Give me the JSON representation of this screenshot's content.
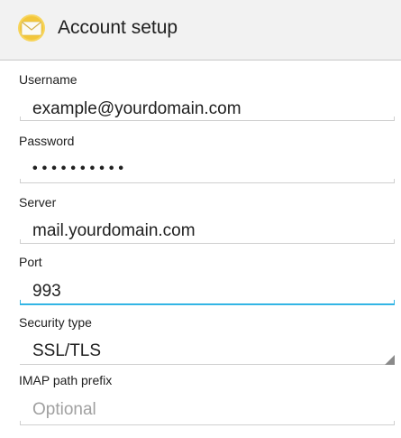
{
  "app_bar": {
    "title": "Account setup",
    "icon": "email-envelope-icon"
  },
  "form": {
    "username": {
      "label": "Username",
      "value": "example@yourdomain.com"
    },
    "password": {
      "label": "Password",
      "masked_value": "••••••••••"
    },
    "server": {
      "label": "Server",
      "value": "mail.yourdomain.com"
    },
    "port": {
      "label": "Port",
      "value": "993"
    },
    "security_type": {
      "label": "Security type",
      "selected": "SSL/TLS"
    },
    "imap_path_prefix": {
      "label": "IMAP path prefix",
      "placeholder": "Optional"
    }
  },
  "colors": {
    "focus_accent": "#33b5e5",
    "app_bar_background": "#f2f2f2",
    "icon_yellow": "#f5c842"
  }
}
